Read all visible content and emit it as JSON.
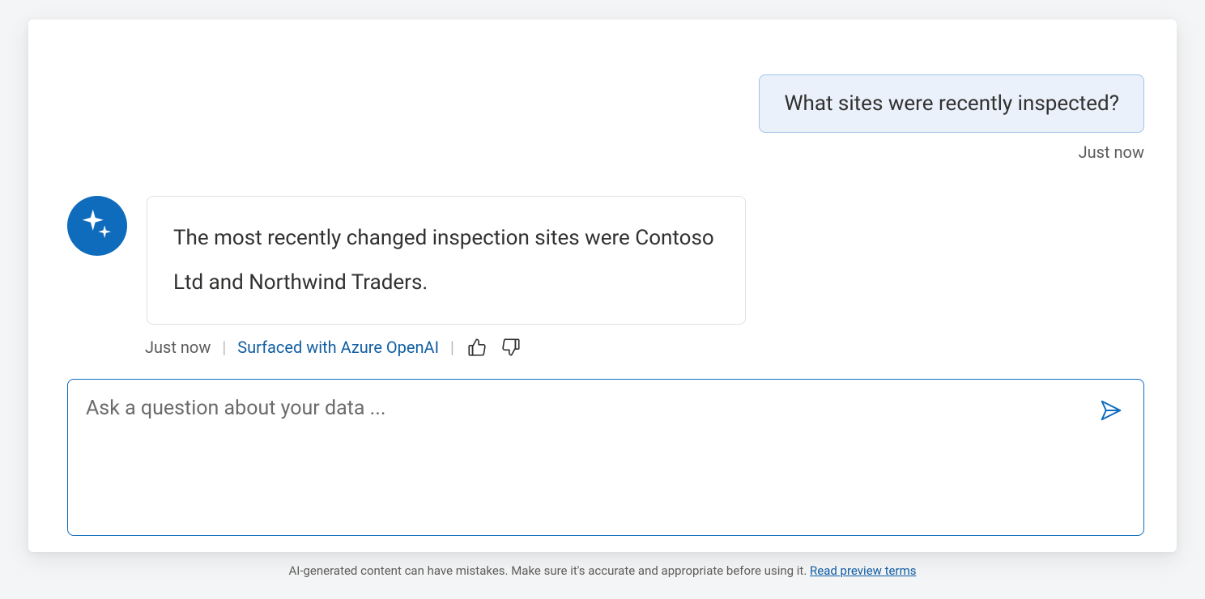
{
  "conversation": {
    "user_message": {
      "text": "What sites were recently inspected?",
      "timestamp": "Just now"
    },
    "bot_message": {
      "text": "The most recently changed inspection sites were Contoso Ltd and Northwind Traders.",
      "timestamp": "Just now",
      "source_label": "Surfaced with Azure OpenAI"
    }
  },
  "composer": {
    "placeholder": "Ask a question about your data ..."
  },
  "disclaimer": {
    "text": "AI-generated content can have mistakes. Make sure it's accurate and appropriate before using it. ",
    "link_label": "Read preview terms"
  },
  "icons": {
    "avatar": "sparkle-icon",
    "like": "thumbs-up-icon",
    "dislike": "thumbs-down-icon",
    "send": "send-icon"
  },
  "colors": {
    "accent": "#0f6cbd",
    "user_bubble_bg": "#eaf1fb",
    "user_bubble_border": "#a2c3ea",
    "link": "#115ea3"
  }
}
